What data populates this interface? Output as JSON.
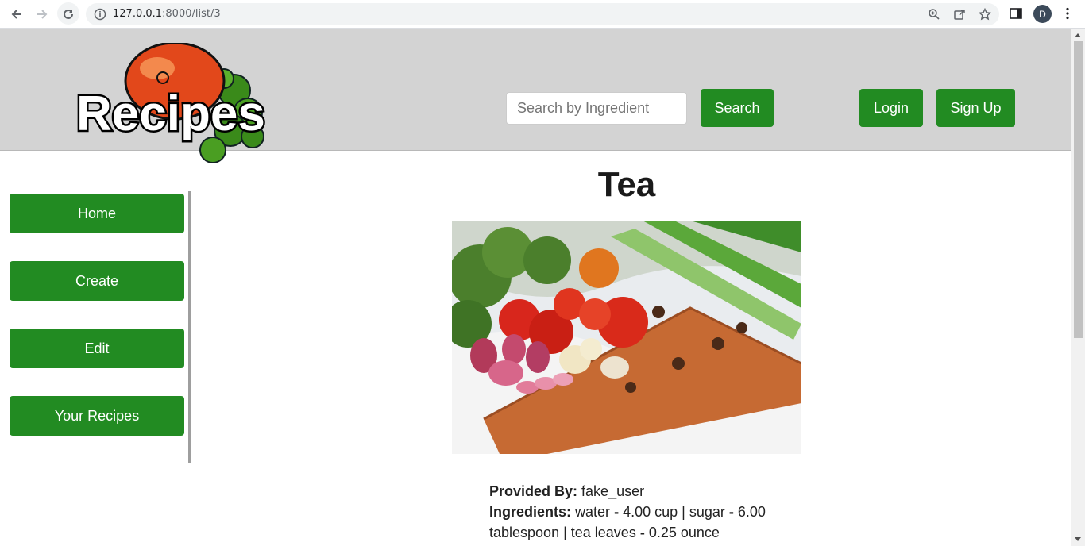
{
  "browser": {
    "url_host": "127.0.0.1",
    "url_path": ":8000/list/3",
    "profile_initial": "D"
  },
  "header": {
    "logo_text": "Recipes",
    "search_placeholder": "Search by Ingredient",
    "search_label": "Search",
    "login_label": "Login",
    "signup_label": "Sign Up"
  },
  "sidebar": {
    "items": [
      {
        "label": "Home"
      },
      {
        "label": "Create"
      },
      {
        "label": "Edit"
      },
      {
        "label": "Your Recipes"
      }
    ]
  },
  "recipe": {
    "title": "Tea",
    "provided_by_label": "Provided By:",
    "provided_by": "fake_user",
    "ingredients_label": "Ingredients:",
    "ingredients": [
      {
        "name": "water",
        "amount": "4.00 cup"
      },
      {
        "name": "sugar",
        "amount": "6.00 tablespoon"
      },
      {
        "name": "tea leaves",
        "amount": "0.25 ounce"
      }
    ]
  },
  "colors": {
    "accent_green": "#228b22",
    "header_bg": "#d3d3d3"
  }
}
